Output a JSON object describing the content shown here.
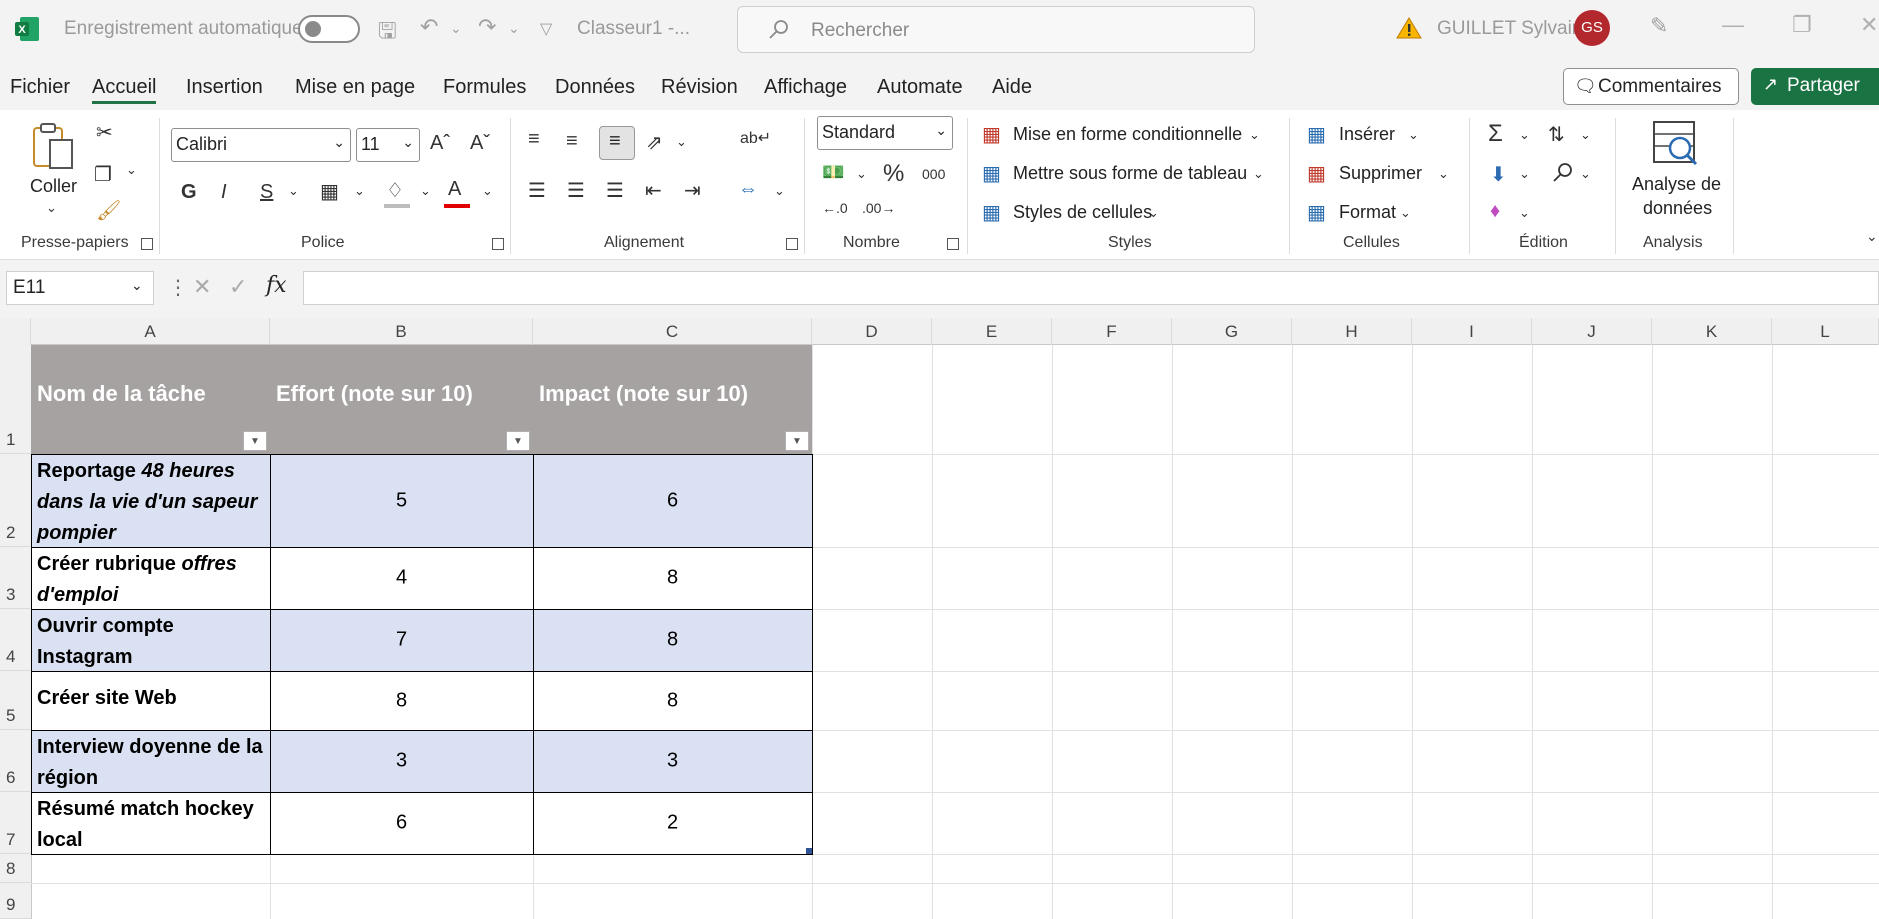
{
  "titlebar": {
    "autosave_label": "Enregistrement automatique",
    "workbook": "Classeur1  -...",
    "search_placeholder": "Rechercher",
    "user_name": "GUILLET Sylvain",
    "user_initials": "GS",
    "warning_icon": "warning-icon",
    "accent_color": "#217346"
  },
  "menu": {
    "tabs": [
      "Fichier",
      "Accueil",
      "Insertion",
      "Mise en page",
      "Formules",
      "Données",
      "Révision",
      "Affichage",
      "Automate",
      "Aide"
    ],
    "active_tab": "Accueil",
    "comments_label": "Commentaires",
    "share_label": "Partager"
  },
  "ribbon": {
    "clipboard": {
      "paste_label": "Coller",
      "group_label": "Presse-papiers"
    },
    "font": {
      "font_name": "Calibri",
      "font_size": "11",
      "bold": "G",
      "italic": "I",
      "underline": "S",
      "group_label": "Police"
    },
    "alignment": {
      "group_label": "Alignement"
    },
    "number": {
      "format": "Standard",
      "percent": "%",
      "thousands": "000",
      "group_label": "Nombre"
    },
    "styles": {
      "conditional": "Mise en forme conditionnelle",
      "as_table": "Mettre sous forme de tableau",
      "cell_styles": "Styles de cellules",
      "group_label": "Styles"
    },
    "cells": {
      "insert": "Insérer",
      "delete": "Supprimer",
      "format": "Format",
      "group_label": "Cellules"
    },
    "editing": {
      "group_label": "Édition"
    },
    "analysis": {
      "button_line1": "Analyse de",
      "button_line2": "données",
      "group_label": "Analysis"
    }
  },
  "formula_bar": {
    "name_box": "E11",
    "fx": "fx",
    "formula": ""
  },
  "sheet": {
    "columns": [
      "A",
      "B",
      "C",
      "D",
      "E",
      "F",
      "G",
      "H",
      "I",
      "J",
      "K",
      "L"
    ],
    "rows": [
      "1",
      "2",
      "3",
      "4",
      "5",
      "6",
      "7",
      "8",
      "9"
    ],
    "table": {
      "headers": [
        "Nom de la tâche",
        "Effort (note sur 10)",
        "Impact (note sur 10)"
      ],
      "header_color": "#a6a2a2",
      "band_color": "#d9e1f2",
      "rows": [
        {
          "name_plain": "Reportage ",
          "name_italic": "48 heures dans la vie d'un sapeur pompier",
          "effort": "5",
          "impact": "6"
        },
        {
          "name_plain": "Créer rubrique ",
          "name_italic": "offres d'emploi",
          "effort": "4",
          "impact": "8"
        },
        {
          "name_plain": "Ouvrir compte Instagram",
          "name_italic": "",
          "effort": "7",
          "impact": "8"
        },
        {
          "name_plain": "Créer site Web",
          "name_italic": "",
          "effort": "8",
          "impact": "8"
        },
        {
          "name_plain": "Interview doyenne de la région",
          "name_italic": "",
          "effort": "3",
          "impact": "3"
        },
        {
          "name_plain": "Résumé match hockey local",
          "name_italic": "",
          "effort": "6",
          "impact": "2"
        }
      ]
    }
  }
}
